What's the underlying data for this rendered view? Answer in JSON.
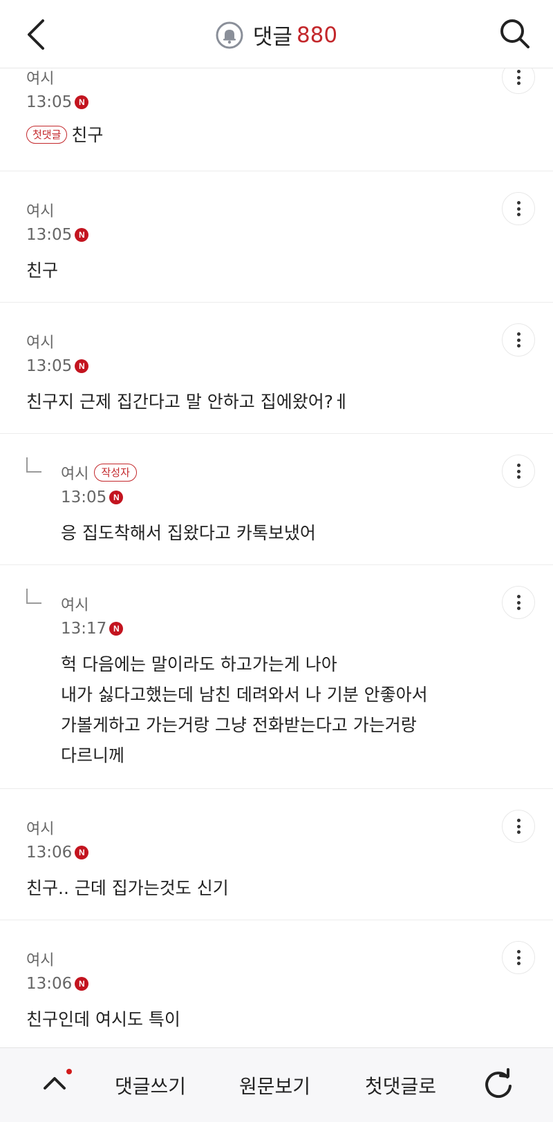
{
  "header": {
    "back_icon": "chevron-left-icon",
    "bell_icon": "bell-icon",
    "title": "댓글",
    "count": "880",
    "search_icon": "search-icon",
    "accent_color": "#c3272b"
  },
  "comments": [
    {
      "author": "여시",
      "time": "13:05",
      "new_badge": "N",
      "first_badge": "첫댓글",
      "lines": [
        "친구"
      ]
    },
    {
      "author": "여시",
      "time": "13:05",
      "new_badge": "N",
      "lines": [
        "친구"
      ]
    },
    {
      "author": "여시",
      "time": "13:05",
      "new_badge": "N",
      "lines": [
        "친구지 근제 집간다고 말 안하고 집에왔어?ㅔ"
      ]
    },
    {
      "author": "여시",
      "author_badge": "작성자",
      "time": "13:05",
      "new_badge": "N",
      "reply": true,
      "lines": [
        "응 집도착해서 집왔다고 카톡보냈어"
      ]
    },
    {
      "author": "여시",
      "time": "13:17",
      "new_badge": "N",
      "reply": true,
      "lines": [
        "헉 다음에는 말이라도 하고가는게 나아",
        "내가 싫다고했는데 남친 데려와서 나 기분 안좋아서",
        "가볼게하고 가는거랑 그냥 전화받는다고 가는거랑",
        "다르니께"
      ]
    },
    {
      "author": "여시",
      "time": "13:06",
      "new_badge": "N",
      "lines": [
        "친구.. 근데 집가는것도 신기"
      ]
    },
    {
      "author": "여시",
      "time": "13:06",
      "new_badge": "N",
      "lines": [
        "친구인데 여시도 특이"
      ]
    }
  ],
  "bottom_bar": {
    "up_icon": "chevron-up-icon",
    "write_label": "댓글쓰기",
    "original_label": "원문보기",
    "first_comment_label": "첫댓글로",
    "refresh_icon": "refresh-icon"
  }
}
